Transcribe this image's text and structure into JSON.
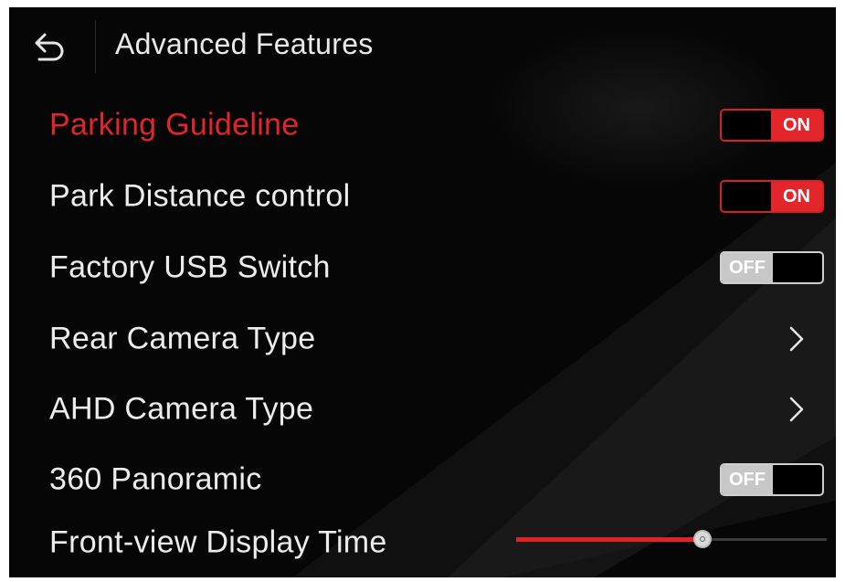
{
  "header": {
    "title": "Advanced Features",
    "back_icon": "back-arrow-icon"
  },
  "settings": [
    {
      "label": "Parking Guideline",
      "type": "toggle",
      "state": "ON"
    },
    {
      "label": "Park Distance control",
      "type": "toggle",
      "state": "ON"
    },
    {
      "label": "Factory USB Switch",
      "type": "toggle",
      "state": "OFF"
    },
    {
      "label": "Rear Camera Type",
      "type": "submenu",
      "icon": "chevron-right-icon"
    },
    {
      "label": "AHD Camera Type",
      "type": "submenu",
      "icon": "chevron-right-icon"
    },
    {
      "label": "360 Panoramic",
      "type": "toggle",
      "state": "OFF"
    },
    {
      "label": "Front-view Display Time",
      "type": "slider",
      "level": 0.6
    }
  ],
  "colors": {
    "accent": "#e0262b",
    "text": "#ececec",
    "background": "#060606",
    "off_knob": "#c7c7c7"
  }
}
